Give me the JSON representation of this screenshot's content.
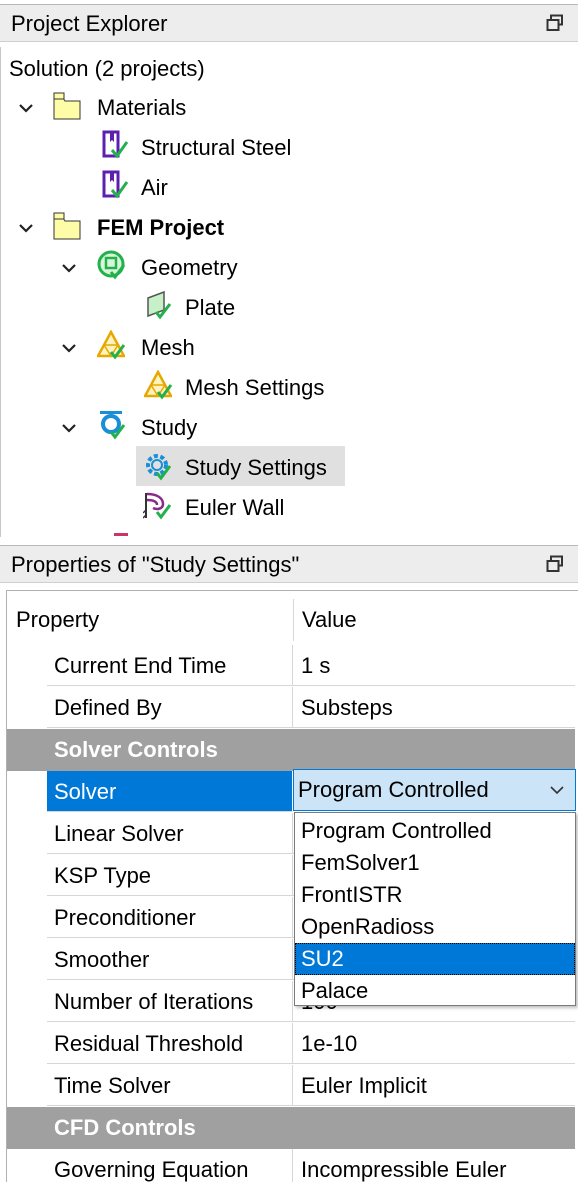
{
  "explorer": {
    "title": "Project Explorer",
    "solution_label": "Solution (2 projects)",
    "nodes": [
      {
        "label": "Materials"
      },
      {
        "label": "Structural Steel"
      },
      {
        "label": "Air"
      },
      {
        "label": "FEM Project"
      },
      {
        "label": "Geometry"
      },
      {
        "label": "Plate"
      },
      {
        "label": "Mesh"
      },
      {
        "label": "Mesh Settings"
      },
      {
        "label": "Study"
      },
      {
        "label": "Study Settings"
      },
      {
        "label": "Euler Wall"
      }
    ]
  },
  "properties": {
    "title": "Properties of \"Study Settings\"",
    "header": {
      "property": "Property",
      "value": "Value"
    },
    "rows": [
      {
        "property": "Current End Time",
        "value": "1 s"
      },
      {
        "property": "Defined By",
        "value": "Substeps"
      }
    ],
    "group1": "Solver Controls",
    "solver": {
      "property": "Solver",
      "value": "Program Controlled"
    },
    "rows2": [
      {
        "property": "Linear Solver",
        "value": ""
      },
      {
        "property": "KSP Type",
        "value": ""
      },
      {
        "property": "Preconditioner",
        "value": ""
      },
      {
        "property": "Smoother",
        "value": ""
      },
      {
        "property": "Number of Iterations",
        "value": "100"
      },
      {
        "property": "Residual Threshold",
        "value": "1e-10"
      },
      {
        "property": "Time Solver",
        "value": "Euler Implicit"
      }
    ],
    "group2": "CFD Controls",
    "rows3": [
      {
        "property": "Governing Equation",
        "value": "Incompressible Euler"
      }
    ]
  },
  "dropdown": {
    "options": [
      "Program Controlled",
      "FemSolver1",
      "FrontISTR",
      "OpenRadioss",
      "SU2",
      "Palace"
    ],
    "highlighted": "SU2"
  },
  "colors": {
    "selection": "#0078d7",
    "group_bg": "#a0a0a0",
    "tree_selected_bg": "#e0e0e0",
    "check_green": "#22b14c"
  }
}
